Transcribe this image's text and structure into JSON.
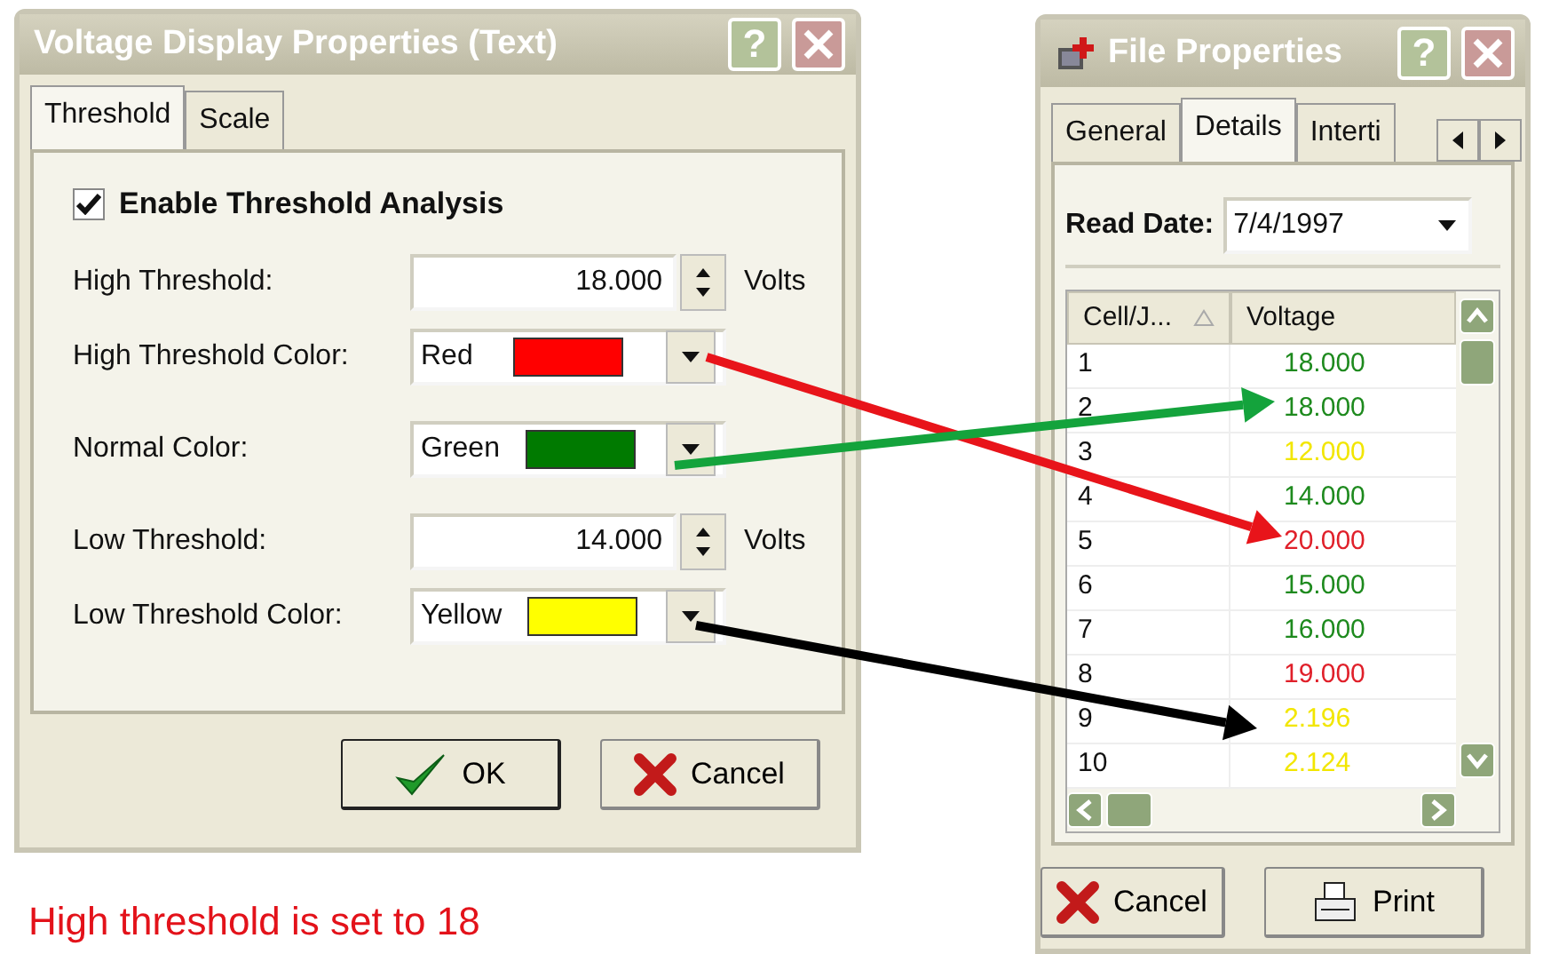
{
  "left_dialog": {
    "title": "Voltage Display Properties (Text)",
    "help": "?",
    "tabs": [
      {
        "label": "Threshold",
        "selected": true
      },
      {
        "label": "Scale",
        "selected": false
      }
    ],
    "enable": {
      "label": "Enable Threshold Analysis",
      "checked": true
    },
    "fields": [
      {
        "kind": "number",
        "label": "High Threshold:",
        "value": "18.000",
        "unit": "Volts"
      },
      {
        "kind": "color",
        "label": "High Threshold Color:",
        "value": "Red",
        "color": "#ff0000"
      },
      {
        "kind": "color",
        "label": "Normal Color:",
        "value": "Green",
        "color": "#007a00"
      },
      {
        "kind": "number",
        "label": "Low Threshold:",
        "value": "14.000",
        "unit": "Volts"
      },
      {
        "kind": "color",
        "label": "Low Threshold Color:",
        "value": "Yellow",
        "color": "#ffff00"
      }
    ],
    "buttons": [
      {
        "kind": "ok",
        "label": "OK"
      },
      {
        "kind": "cancel",
        "label": "Cancel"
      }
    ]
  },
  "caption": "High threshold is set to 18",
  "right_dialog": {
    "title": "File Properties",
    "help": "?",
    "tabs": [
      {
        "label": "General",
        "selected": false
      },
      {
        "label": "Details",
        "selected": true
      },
      {
        "label": "Interti",
        "selected": false
      }
    ],
    "read_date": {
      "label": "Read Date:",
      "value": "7/4/1997"
    },
    "table": {
      "columns": [
        "Cell/J...",
        "Voltage"
      ],
      "rows": [
        {
          "cells": [
            "1",
            "18.000"
          ],
          "color": "#1e8a1e"
        },
        {
          "cells": [
            "2",
            "18.000"
          ],
          "color": "#1e8a1e"
        },
        {
          "cells": [
            "3",
            "12.000"
          ],
          "color": "#f2e600"
        },
        {
          "cells": [
            "4",
            "14.000"
          ],
          "color": "#1e8a1e"
        },
        {
          "cells": [
            "5",
            "20.000"
          ],
          "color": "#e0202a"
        },
        {
          "cells": [
            "6",
            "15.000"
          ],
          "color": "#1e8a1e"
        },
        {
          "cells": [
            "7",
            "16.000"
          ],
          "color": "#1e8a1e"
        },
        {
          "cells": [
            "8",
            "19.000"
          ],
          "color": "#e0202a"
        },
        {
          "cells": [
            "9",
            "2.196"
          ],
          "color": "#f2e600"
        },
        {
          "cells": [
            "10",
            "2.124"
          ],
          "color": "#f2e600"
        }
      ]
    },
    "buttons": [
      {
        "kind": "cancel",
        "label": "Cancel"
      },
      {
        "kind": "print",
        "label": "Print"
      }
    ]
  }
}
